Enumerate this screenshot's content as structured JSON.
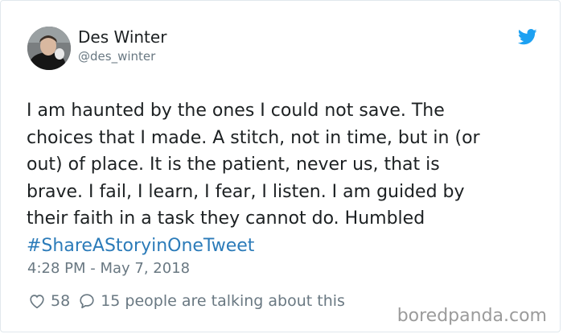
{
  "author": {
    "display_name": "Des Winter",
    "handle": "@des_winter",
    "avatar_icon": "avatar-photo",
    "brand_icon": "twitter-bird-icon"
  },
  "tweet": {
    "lines": [
      "I am haunted by the ones I could not save. The",
      "choices that I made. A stitch, not in time, but in (or",
      "out) of place. It is the patient, never us, that is",
      "brave. I fail, I learn, I fear, I listen. I am guided by",
      "their faith in a task they cannot do. Humbled"
    ],
    "hashtag": "#ShareAStoryinOneTweet",
    "timestamp": "4:28 PM - May 7, 2018"
  },
  "engagement": {
    "likes": "58",
    "talking": "15 people are talking about this"
  },
  "watermark": "boredpanda.com",
  "colors": {
    "text": "#1c2022",
    "muted": "#697882",
    "hashtag": "#2b7bb9",
    "twitter_blue": "#1da1f2",
    "border": "#e1e8ed"
  }
}
